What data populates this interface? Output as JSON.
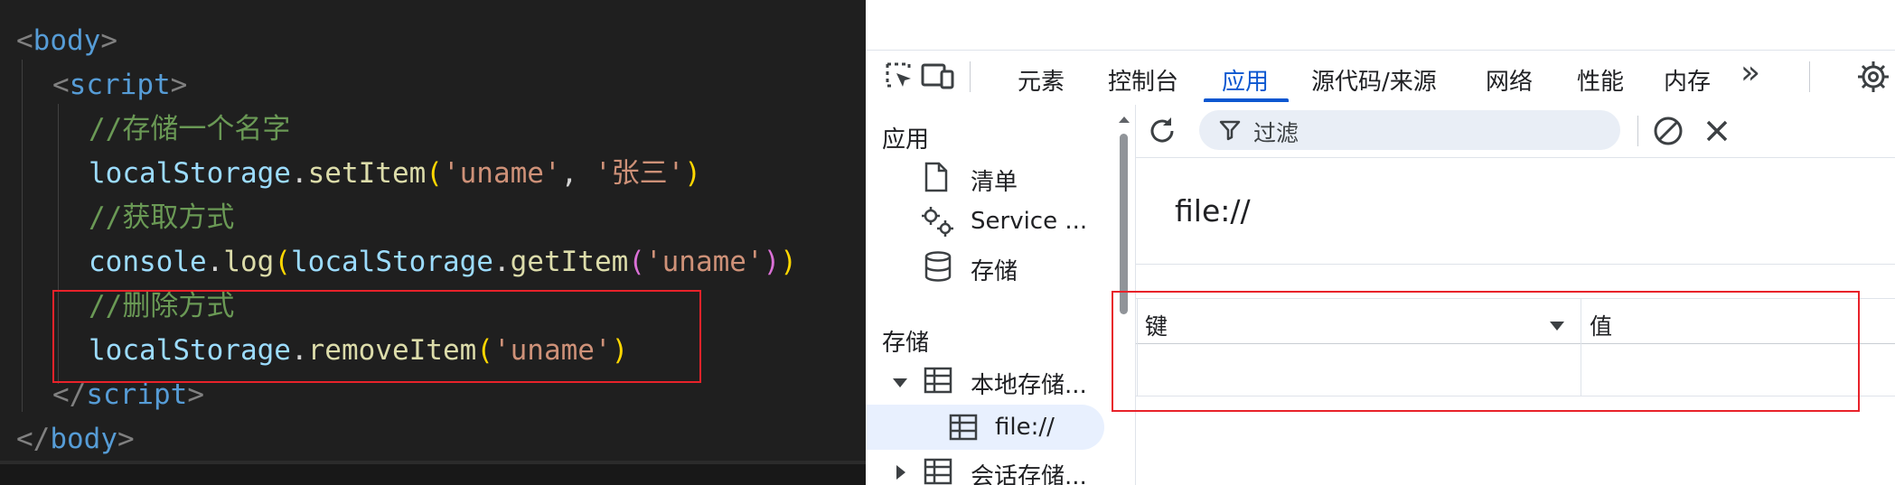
{
  "editor": {
    "line1": {
      "open": "<",
      "tag": "body",
      "close": ">"
    },
    "line2": {
      "open": "<",
      "tag": "script",
      "close": ">"
    },
    "comment_store": "//存储一个名字",
    "set_call": {
      "obj": "localStorage",
      "dot": ".",
      "method": "setItem",
      "paren_open": "(",
      "arg1": "'uname'",
      "comma": ", ",
      "arg2": "'张三'",
      "paren_close": ")"
    },
    "comment_get": "//获取方式",
    "get_call": {
      "obj": "console",
      "dot": ".",
      "method": "log",
      "p_open": "(",
      "inner_obj": "localStorage",
      "inner_dot": ".",
      "inner_method": "getItem",
      "pi_open": "(",
      "arg": "'uname'",
      "pi_close": ")",
      "p_close": ")"
    },
    "comment_remove": "//删除方式",
    "remove_call": {
      "obj": "localStorage",
      "dot": ".",
      "method": "removeItem",
      "paren_open": "(",
      "arg": "'uname'",
      "paren_close": ")"
    },
    "line9": {
      "open": "</",
      "tag": "script",
      "close": ">"
    },
    "line10": {
      "open": "</",
      "tag": "body",
      "close": ">"
    }
  },
  "devtools": {
    "tabs": [
      {
        "label": "元素",
        "active": false
      },
      {
        "label": "控制台",
        "active": false
      },
      {
        "label": "应用",
        "active": true
      },
      {
        "label": "源代码/来源",
        "active": false
      },
      {
        "label": "网络",
        "active": false
      },
      {
        "label": "性能",
        "active": false
      },
      {
        "label": "内存",
        "active": false
      }
    ],
    "more_tabs_glyph": "»",
    "sidebar": {
      "app_heading": "应用",
      "app_items": [
        {
          "label": "清单",
          "icon": "document-icon"
        },
        {
          "label": "Service ...",
          "icon": "gears-icon"
        },
        {
          "label": "存储",
          "icon": "database-icon"
        }
      ],
      "storage_heading": "存储",
      "local_storage": "本地存储...",
      "local_storage_child": "file://",
      "session_storage": "会话存储..."
    },
    "toolbar": {
      "filter_placeholder": "过滤"
    },
    "origin": "file://",
    "table": {
      "columns": [
        "键",
        "值"
      ],
      "rows": []
    },
    "colors": {
      "accent": "#0b57d0",
      "highlight": "#e8222a"
    }
  }
}
